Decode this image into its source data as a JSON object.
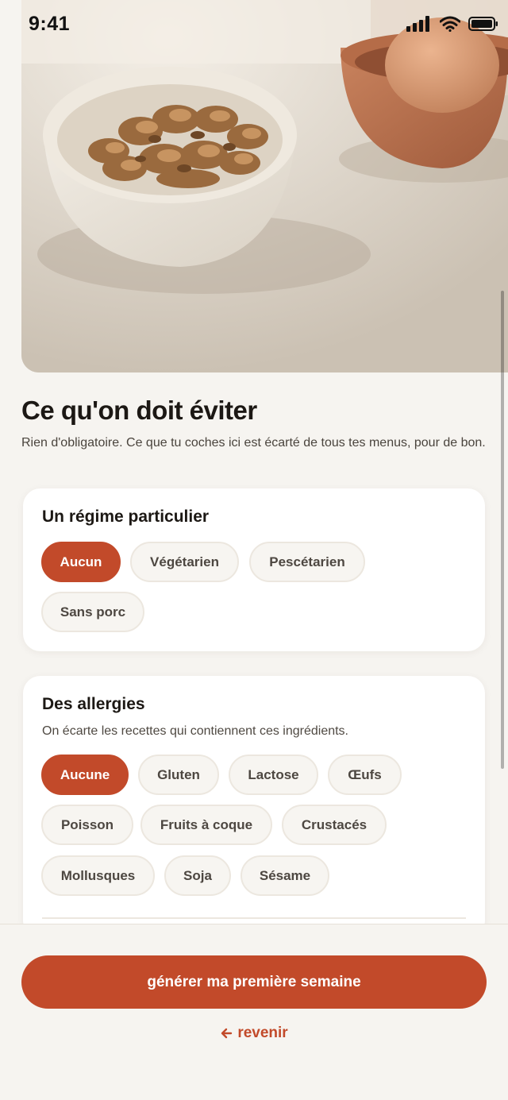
{
  "status_bar": {
    "time": "9:41",
    "icons": [
      "signal-icon",
      "wifi-icon",
      "battery-icon"
    ]
  },
  "hero": {
    "image": "bowl-of-walnuts-photo"
  },
  "header": {
    "title": "Ce qu'on doit éviter",
    "subtitle": "Rien d'obligatoire. Ce que tu coches ici est écarté de tous tes menus, pour de bon."
  },
  "diet": {
    "title": "Un régime particulier",
    "options": [
      {
        "label": "Aucun",
        "selected": true
      },
      {
        "label": "Végétarien",
        "selected": false
      },
      {
        "label": "Pescétarien",
        "selected": false
      },
      {
        "label": "Sans porc",
        "selected": false
      }
    ]
  },
  "allergies": {
    "title": "Des allergies",
    "description": "On écarte les recettes qui contiennent ces ingrédients.",
    "options": [
      {
        "label": "Aucune",
        "selected": true
      },
      {
        "label": "Gluten",
        "selected": false
      },
      {
        "label": "Lactose",
        "selected": false
      },
      {
        "label": "Œufs",
        "selected": false
      },
      {
        "label": "Poisson",
        "selected": false
      },
      {
        "label": "Fruits à coque",
        "selected": false
      },
      {
        "label": "Crustacés",
        "selected": false
      },
      {
        "label": "Mollusques",
        "selected": false
      },
      {
        "label": "Soja",
        "selected": false
      },
      {
        "label": "Sésame",
        "selected": false
      }
    ]
  },
  "footer": {
    "primary_label": "générer ma première semaine",
    "back_label": "revenir",
    "back_icon": "arrow-left-icon"
  },
  "colors": {
    "accent": "#c24a2a",
    "background": "#f6f4f0",
    "card": "#ffffff",
    "chip_bg": "#f7f5f1"
  }
}
